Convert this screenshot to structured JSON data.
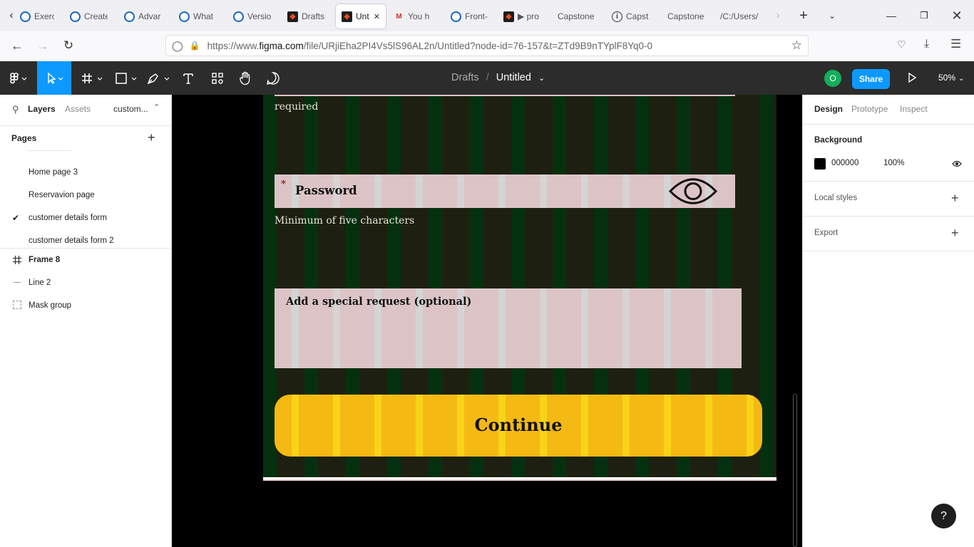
{
  "browser": {
    "tabs": [
      {
        "label": "Exerci",
        "icon": "google-classroom-icon"
      },
      {
        "label": "Create",
        "icon": "google-classroom-icon"
      },
      {
        "label": "Advar",
        "icon": "google-classroom-icon"
      },
      {
        "label": "What",
        "icon": "google-classroom-icon"
      },
      {
        "label": "Versio",
        "icon": "google-classroom-icon"
      },
      {
        "label": "Drafts",
        "icon": "figma-icon"
      },
      {
        "label": "Unt",
        "icon": "figma-icon",
        "active": true
      },
      {
        "label": "You h",
        "icon": "gmail-icon"
      },
      {
        "label": "Front-",
        "icon": "google-classroom-icon"
      },
      {
        "label": "▶ pro",
        "icon": "figma-icon"
      },
      {
        "label": "Capstone",
        "icon": ""
      },
      {
        "label": "Capst",
        "icon": "info-icon"
      },
      {
        "label": "Capstone",
        "icon": ""
      },
      {
        "label": "/C:/Users/",
        "icon": ""
      }
    ],
    "url_prefix": "https://www.",
    "url_host": "figma.com",
    "url_rest": "/file/URjiEha2PI4Vs5lS96AL2n/Untitled?node-id=76-157&t=ZTd9B9nTYplF8Yq0-0"
  },
  "figma": {
    "breadcrumb_parent": "Drafts",
    "breadcrumb_sep": "/",
    "file_name": "Untitled",
    "avatar_initial": "O",
    "share_label": "Share",
    "zoom": "50%",
    "left_tabs": {
      "layers": "Layers",
      "assets": "Assets",
      "page_dropdown": "custom..."
    },
    "pages_heading": "Pages",
    "pages": [
      "Home page 3",
      "Reservavion page",
      "customer details form",
      "customer details form 2"
    ],
    "current_page": "customer details form",
    "layers": [
      {
        "name": "Frame 8",
        "icon": "frame-icon"
      },
      {
        "name": "Line 2",
        "icon": "line-icon"
      },
      {
        "name": "Mask group",
        "icon": "mask-group-icon"
      }
    ],
    "right_tabs": {
      "design": "Design",
      "prototype": "Prototype",
      "inspect": "Inspect"
    },
    "background_heading": "Background",
    "background_hex": "000000",
    "background_opacity": "100%",
    "local_styles": "Local styles",
    "export": "Export",
    "help": "?"
  },
  "design": {
    "required_text": "required",
    "password_asterisk": "*",
    "password_label": "Password",
    "password_hint": "Minimum of five characters",
    "special_request_label": "Add a special request (optional)",
    "continue_label": "Continue"
  },
  "colors": {
    "accent_blue": "#0d99ff",
    "button_yellow": "#f5b914",
    "field_pink": "#dcc4c6",
    "frame_bg": "#1d2010",
    "grid_green": "#05300f"
  }
}
